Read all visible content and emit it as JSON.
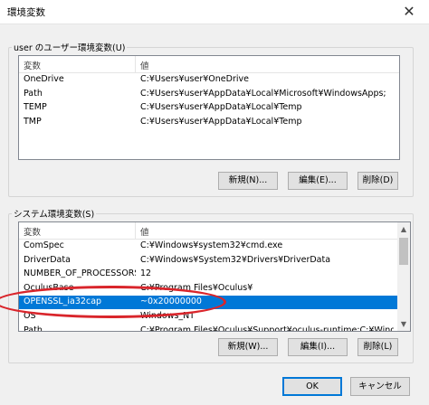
{
  "window": {
    "title": "環境変数"
  },
  "user_section": {
    "label": "user のユーザー環境変数(U)",
    "columns": [
      "変数",
      "値"
    ],
    "rows": [
      {
        "name": "OneDrive",
        "value": "C:¥Users¥user¥OneDrive"
      },
      {
        "name": "Path",
        "value": "C:¥Users¥user¥AppData¥Local¥Microsoft¥WindowsApps;"
      },
      {
        "name": "TEMP",
        "value": "C:¥Users¥user¥AppData¥Local¥Temp"
      },
      {
        "name": "TMP",
        "value": "C:¥Users¥user¥AppData¥Local¥Temp"
      }
    ],
    "buttons": {
      "new": "新規(N)...",
      "edit": "編集(E)...",
      "delete": "削除(D)"
    }
  },
  "system_section": {
    "label": "システム環境変数(S)",
    "columns": [
      "変数",
      "値"
    ],
    "rows": [
      {
        "name": "ComSpec",
        "value": "C:¥Windows¥system32¥cmd.exe"
      },
      {
        "name": "DriverData",
        "value": "C:¥Windows¥System32¥Drivers¥DriverData"
      },
      {
        "name": "NUMBER_OF_PROCESSORS",
        "value": "12"
      },
      {
        "name": "OculusBase",
        "value": "C:¥Program Files¥Oculus¥"
      },
      {
        "name": "OPENSSL_ia32cap",
        "value": "~0x20000000"
      },
      {
        "name": "OS",
        "value": "Windows_NT"
      },
      {
        "name": "Path",
        "value": "C:¥Program Files¥Oculus¥Support¥oculus-runtime;C:¥Windows¥sys..."
      }
    ],
    "selected_index": 4,
    "buttons": {
      "new": "新規(W)...",
      "edit": "編集(I)...",
      "delete": "削除(L)"
    }
  },
  "footer": {
    "ok": "OK",
    "cancel": "キャンセル"
  },
  "colors": {
    "selection": "#0078d7",
    "annotation": "#d9252b"
  }
}
